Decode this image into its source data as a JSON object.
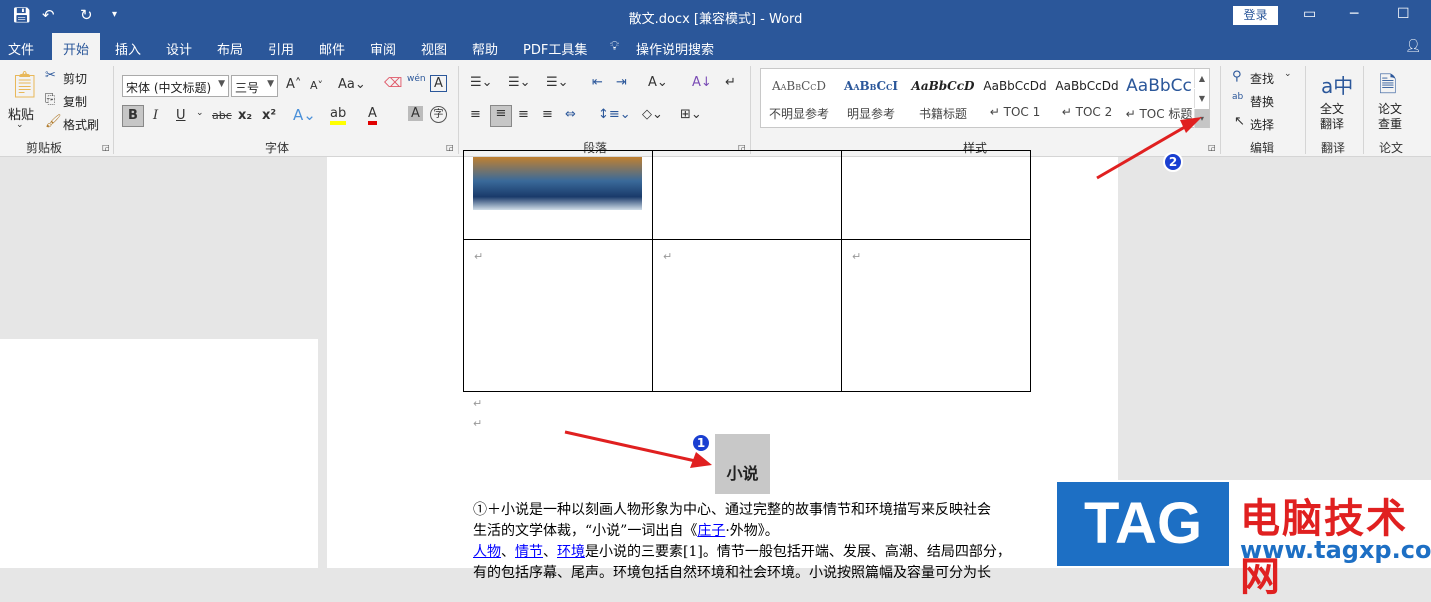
{
  "window": {
    "title": "散文.docx [兼容模式] - Word",
    "login": "登录"
  },
  "tabs": [
    "文件",
    "开始",
    "插入",
    "设计",
    "布局",
    "引用",
    "邮件",
    "审阅",
    "视图",
    "帮助",
    "PDF工具集",
    "操作说明搜索"
  ],
  "clipboard": {
    "paste": "粘贴",
    "cut": "剪切",
    "copy": "复制",
    "format_painter": "格式刷",
    "label": "剪贴板"
  },
  "font": {
    "name": "宋体 (中文标题)",
    "size": "三号",
    "label": "字体",
    "bold": "B",
    "italic": "I",
    "underline": "U",
    "strike": "abc",
    "sub": "x₂",
    "sup": "x²",
    "phonetic": "wén"
  },
  "paragraph": {
    "label": "段落"
  },
  "styles": {
    "label": "样式",
    "items": [
      {
        "preview": "AaBbCcD",
        "name": "不明显参考"
      },
      {
        "preview": "AaBbCcI",
        "name": "明显参考"
      },
      {
        "preview": "AaBbCcD",
        "name": "书籍标题"
      },
      {
        "preview": "AaBbCcDd",
        "name": "↵ TOC 1"
      },
      {
        "preview": "AaBbCcDd",
        "name": "↵ TOC 2"
      },
      {
        "preview": "AaBbCc",
        "name": "↵ TOC 标题"
      }
    ]
  },
  "editing": {
    "find": "查找",
    "replace": "替换",
    "select": "选择",
    "label": "编辑"
  },
  "translate": {
    "button": "全文翻译",
    "label": "翻译"
  },
  "thesis": {
    "button": "论文查重",
    "label": "论文"
  },
  "document": {
    "heading": "小说",
    "p1a": "①＋小说是一种以刻画人物形象为中心、通过完整的故事情节和环境描写来反映社会",
    "p1b_pre": "生活的文学体裁，“小说”一词出自《",
    "p1b_link": "庄子",
    "p1b_post": "·外物》。",
    "p2_link1": "人物",
    "p2_sep1": "、",
    "p2_link2": "情节",
    "p2_sep2": "、",
    "p2_link3": "环境",
    "p2_post": "是小说的三要素[1]。情节一般包括开端、发展、高潮、结局四部分，",
    "p3": "有的包括序幕、尾声。环境包括自然环境和社会环境。小说按照篇幅及容量可分为长"
  },
  "annotations": {
    "badge1": "1",
    "badge2": "2"
  },
  "watermark": {
    "logo": "TAG",
    "site_name": "电脑技术网",
    "url": "www.tagxp.com"
  }
}
